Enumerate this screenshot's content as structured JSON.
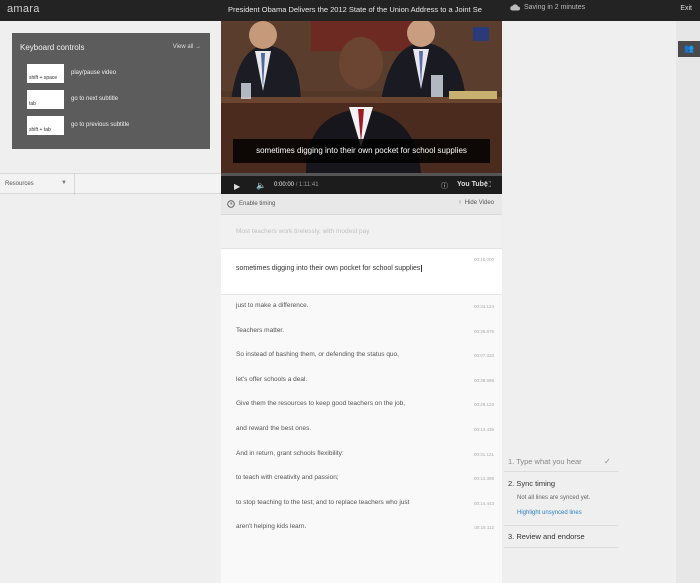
{
  "header": {
    "brand": "amara",
    "video_title": "President Obama Delivers the 2012 State of the Union Address to a Joint Se",
    "saving_status": "Saving in 2 minutes",
    "exit_label": "Exit"
  },
  "keyboard": {
    "title": "Keyboard controls",
    "view_all": "View all →",
    "shortcuts": [
      {
        "key": "shift + space",
        "action": "play/pause video"
      },
      {
        "key": "tab",
        "action": "go to next subtitle"
      },
      {
        "key": "shift + tab",
        "action": "go to previous subtitle"
      }
    ]
  },
  "resources": {
    "label": "Resources",
    "caret": "▼"
  },
  "player": {
    "caption": "sometimes digging into their own pocket for school supplies",
    "current_time": "0:00:00",
    "duration": "/ 1:11:41",
    "progress_fraction": 0.0,
    "yt_label": "You Tube",
    "play_icon": "▶",
    "volume_icon": "🔈",
    "info_icon": "ⓘ",
    "fullscreen_icon": "⛶"
  },
  "toolbar": {
    "enable_timing": "Enable timing",
    "hide_video": "Hide Video"
  },
  "subtitles": {
    "previous": "Most teachers work tirelessly, with modest pay",
    "current": {
      "text": "sometimes digging into their own pocket for school supplies",
      "time": "00:10.000"
    },
    "upcoming": [
      {
        "text": "just to make a difference.",
        "time": "00:34.124"
      },
      {
        "text": "Teachers matter.",
        "time": "00:35.876"
      },
      {
        "text": "So instead of bashing them, or defending the status quo,",
        "time": "00:07.333"
      },
      {
        "text": "let's offer schools a deal.",
        "time": "00:38.998"
      },
      {
        "text": "Give them the resources to keep good teachers on the job,",
        "time": "00:29.123"
      },
      {
        "text": "and reward the best ones.",
        "time": "00:13.435"
      },
      {
        "text": "And in return, grant schools flexibility:",
        "time": "00:31.121"
      },
      {
        "text": "to teach with creativity and passion;",
        "time": "00:13.399"
      },
      {
        "text": "to stop teaching to the test; and to replace teachers who just",
        "time": "00:14.443"
      },
      {
        "text": "aren't helping kids learn.",
        "time": "00:15.112"
      }
    ]
  },
  "steps": {
    "step1": "1. Type what you hear",
    "step1_check": "✓",
    "step2": "2. Sync timing",
    "step2_note": "Not all lines are synced yet.",
    "step2_link": "Highlight unsynced lines",
    "step3": "3. Review and endorse"
  },
  "colors": {
    "topbar": "#232323",
    "keyboard_panel": "#5c5c5c",
    "progress_fill": "#cc2222",
    "link": "#2a7fbf"
  }
}
